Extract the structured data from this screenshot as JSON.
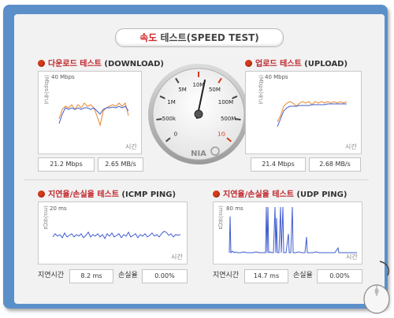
{
  "title": {
    "highlight": "속도",
    "rest": " 테스트(SPEED TEST)"
  },
  "download": {
    "title_kr": "다운로드 테스트",
    "title_en": "(DOWNLOAD)",
    "y_max": "40 Mbps",
    "y_label": "(Mbps)속도",
    "x_label": "시간",
    "mbps": "21.2 Mbps",
    "mbs": "2.65 MB/s"
  },
  "upload": {
    "title_kr": "업로드 테스트",
    "title_en": "(UPLOAD)",
    "y_max": "40 Mbps",
    "y_label": "(Mbps)속도",
    "x_label": "시간",
    "mbps": "21.4 Mbps",
    "mbs": "2.68 MB/s"
  },
  "gauge": {
    "labels": [
      "0",
      "500k",
      "1M",
      "5M",
      "10M",
      "50M",
      "100M",
      "500M",
      "1G"
    ],
    "logo": "NIA",
    "needle_value": "10M"
  },
  "icmp": {
    "title_kr": "지연율/손실율 테스트",
    "title_en": "(ICMP PING)",
    "y_max": "20 ms",
    "y_label": "(ms)응답",
    "x_label": "시간",
    "latency_label": "지연시간",
    "latency": "8.2 ms",
    "loss_label": "손실율",
    "loss": "0.00%"
  },
  "udp": {
    "title_kr": "지연율/손실율 테스트",
    "title_en": "(UDP PING)",
    "y_max": "80 ms",
    "y_label": "(ms)응답",
    "x_label": "시간",
    "latency_label": "지연시간",
    "latency": "14.7 ms",
    "loss_label": "손실율",
    "loss": "0.00%"
  },
  "colors": {
    "accent": "#c0262c",
    "frame": "#5b8fc9",
    "series_orange": "#e8862a",
    "series_blue": "#3f5ccf"
  },
  "icons": {
    "bullet": "red-dot-icon",
    "mouse": "mouse-icon"
  }
}
